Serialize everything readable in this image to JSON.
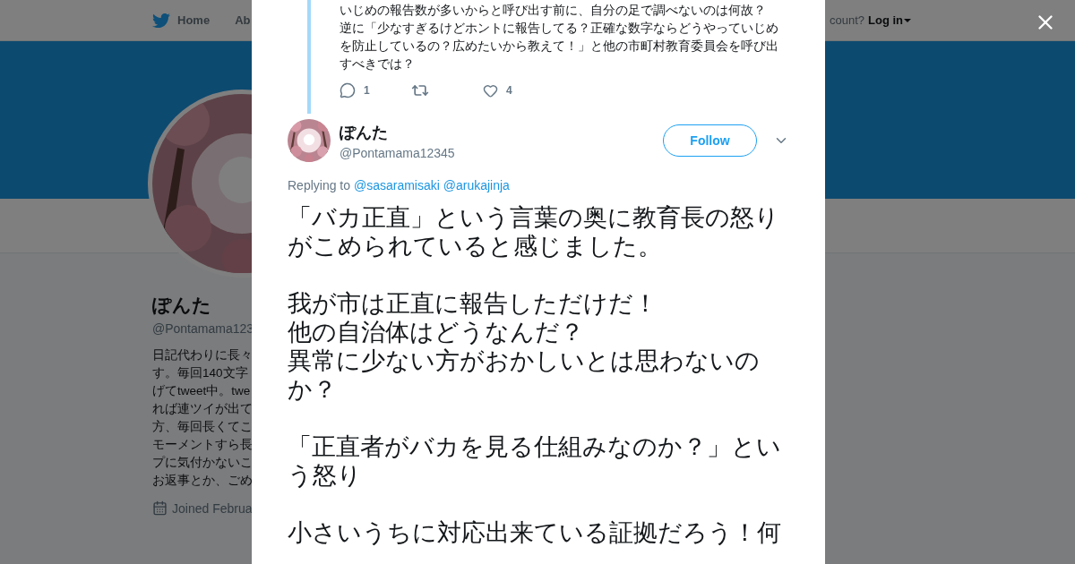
{
  "nav": {
    "home": "Home",
    "about": "Ab",
    "account_prompt": "count?",
    "login": "Log in"
  },
  "profile": {
    "name": "ぽんた",
    "handle": "@Pontamama123",
    "bio_lines": [
      "日記代わりに長々",
      "す。毎回140文字",
      "げてtweet中。twe",
      "れば連ツイが出て",
      "方、毎回長くてこ",
      "モーメントすら長",
      "プに気付かないこ",
      "お返事とか、ごめ"
    ],
    "joined": "Joined Februa"
  },
  "modal": {
    "parent_tweet": {
      "lines": [
        "いじめの報告数が多いからと呼び出す前に、自分の足で調べないのは何故？",
        "逆に「少なすぎるけどホントに報告してる？正確な数字ならどうやっていじめ",
        "を防止しているの？広めたいから教えて！」と他の市町村教育委員会を呼び出",
        "すべきでは？"
      ],
      "replies": "1",
      "likes": "4"
    },
    "tweet": {
      "name": "ぽんた",
      "handle": "@Pontamama12345",
      "follow": "Follow",
      "replying_label": "Replying to",
      "reply_targets": [
        "@sasaramisaki",
        "@arukajinja"
      ],
      "paragraphs": [
        [
          "「バカ正直」という言葉の奥に教育長の怒り",
          "がこめられていると感じました。"
        ],
        [
          "我が市は正直に報告しただけだ！",
          "他の自治体はどうなんだ？",
          "異常に少ない方がおかしいとは思わないの",
          "か？"
        ],
        [
          "「正直者がバカを見る仕組みなのか？」とい",
          "う怒り"
        ],
        [
          "小さいうちに対応出来ている証拠だろう！何"
        ]
      ]
    }
  }
}
